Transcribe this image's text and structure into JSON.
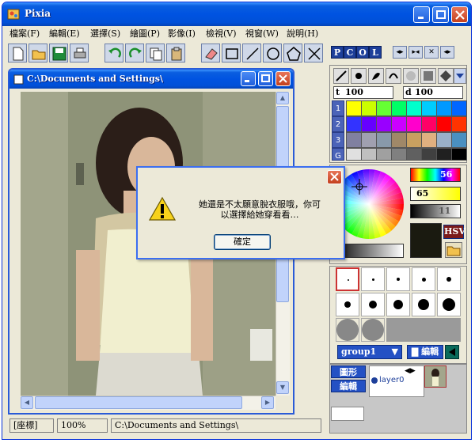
{
  "app": {
    "title": "Pixia"
  },
  "menu": [
    "檔案(F)",
    "編輯(E)",
    "選擇(S)",
    "繪圖(P)",
    "影像(I)",
    "檢視(V)",
    "視窗(W)",
    "說明(H)"
  ],
  "panel_tabs": [
    "P",
    "C",
    "O",
    "L"
  ],
  "document": {
    "title": "C:\\Documents and Settings\\"
  },
  "status": {
    "coords": "[座標]",
    "zoom": "100%",
    "path": "C:\\Documents and Settings\\"
  },
  "brush_panel": {
    "opacity_label": "t",
    "opacity": "100",
    "density_label": "d",
    "density": "100"
  },
  "palette_rows": [
    "1",
    "2",
    "3",
    "G"
  ],
  "color_panel": {
    "hue": "56",
    "saturation": "65",
    "luminance": "11",
    "mode": "HSV"
  },
  "layers": {
    "group_name": "group1",
    "edit_label": "編輯",
    "shape_label": "圖形",
    "layer_name": "layer0"
  },
  "dialog": {
    "message": "她還是不太願意脫衣服哦，你可以選擇給她穿看看…",
    "ok": "確定"
  },
  "colors": {
    "title_blue": "#0053e1",
    "panel_bg": "#ece9d8",
    "dialog_border": "#3b6ef1"
  }
}
